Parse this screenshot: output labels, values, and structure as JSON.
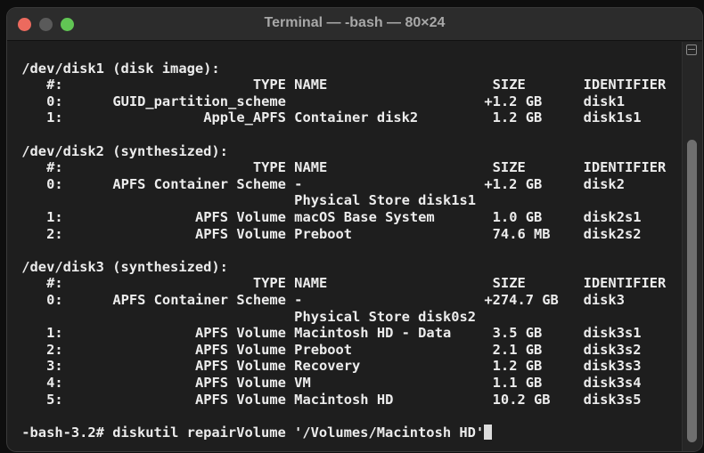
{
  "window": {
    "title": "Terminal — -bash — 80×24"
  },
  "colors": {
    "close": "#ec6a5e",
    "minimize": "#5a5a5a",
    "zoom": "#61c554"
  },
  "headers": {
    "num": "#:",
    "type": "TYPE",
    "name": "NAME",
    "size": "SIZE",
    "identifier": "IDENTIFIER"
  },
  "disks": [
    {
      "title": "/dev/disk1 (disk image):",
      "rows": [
        {
          "num": "0:",
          "type": "GUID_partition_scheme",
          "name": "",
          "size": "+1.2 GB",
          "id": "disk1"
        },
        {
          "num": "1:",
          "type": "Apple_APFS",
          "name": "Container disk2",
          "size": "1.2 GB",
          "id": "disk1s1"
        }
      ]
    },
    {
      "title": "/dev/disk2 (synthesized):",
      "rows": [
        {
          "num": "0:",
          "type": "APFS Container Scheme",
          "name": "-",
          "size": "+1.2 GB",
          "id": "disk2",
          "extra": "Physical Store disk1s1"
        },
        {
          "num": "1:",
          "type": "APFS Volume",
          "name": "macOS Base System",
          "size": "1.0 GB",
          "id": "disk2s1"
        },
        {
          "num": "2:",
          "type": "APFS Volume",
          "name": "Preboot",
          "size": "74.6 MB",
          "id": "disk2s2"
        }
      ]
    },
    {
      "title": "/dev/disk3 (synthesized):",
      "rows": [
        {
          "num": "0:",
          "type": "APFS Container Scheme",
          "name": "-",
          "size": "+274.7 GB",
          "id": "disk3",
          "extra": "Physical Store disk0s2"
        },
        {
          "num": "1:",
          "type": "APFS Volume",
          "name": "Macintosh HD - Data",
          "size": "3.5 GB",
          "id": "disk3s1"
        },
        {
          "num": "2:",
          "type": "APFS Volume",
          "name": "Preboot",
          "size": "2.1 GB",
          "id": "disk3s2"
        },
        {
          "num": "3:",
          "type": "APFS Volume",
          "name": "Recovery",
          "size": "1.2 GB",
          "id": "disk3s3"
        },
        {
          "num": "4:",
          "type": "APFS Volume",
          "name": "VM",
          "size": "1.1 GB",
          "id": "disk3s4"
        },
        {
          "num": "5:",
          "type": "APFS Volume",
          "name": "Macintosh HD",
          "size": "10.2 GB",
          "id": "disk3s5"
        }
      ]
    }
  ],
  "prompt": {
    "text": "-bash-3.2# ",
    "command": "diskutil repairVolume '/Volumes/Macintosh HD'"
  }
}
